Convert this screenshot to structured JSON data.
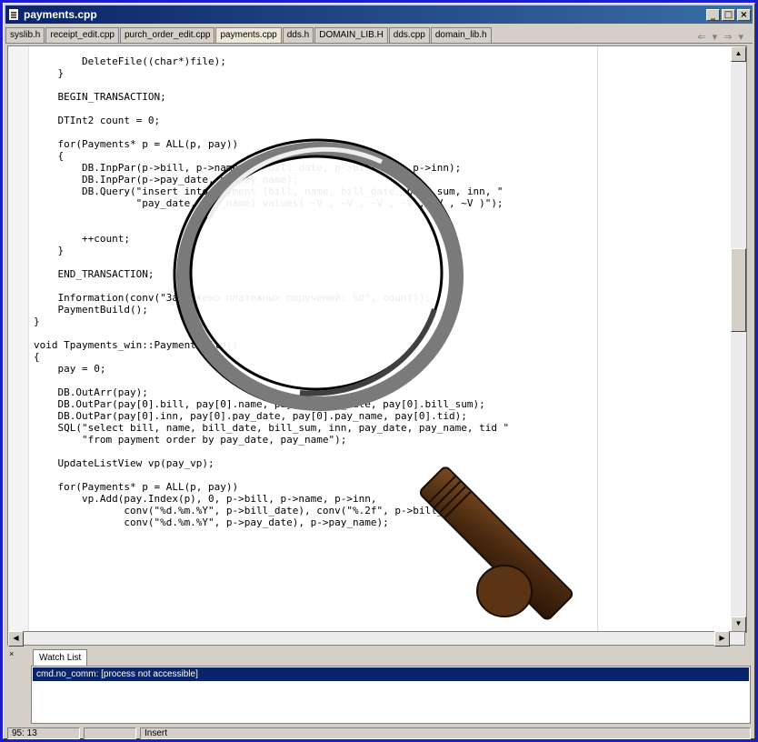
{
  "window": {
    "title": "payments.cpp",
    "btn_min": "_",
    "btn_max": "□",
    "btn_close": "×"
  },
  "tabs": [
    {
      "label": "syslib.h"
    },
    {
      "label": "receipt_edit.cpp"
    },
    {
      "label": "purch_order_edit.cpp"
    },
    {
      "label": "payments.cpp",
      "active": true
    },
    {
      "label": "dds.h"
    },
    {
      "label": "DOMAIN_LIB.H"
    },
    {
      "label": "dds.cpp"
    },
    {
      "label": "domain_lib.h"
    }
  ],
  "tab_nav": "⇐ ▾ ⇒ ▾",
  "code": {
    "lines": [
      "        DeleteFile((char*)file);",
      "    }",
      "",
      "    BEGIN_TRANSACTION;",
      "",
      "    DTInt2 count = 0;",
      "",
      "    for(Payments* p = ALL(p, pay))",
      "    {",
      "        DB.InpPar(p->bill, p->name, p->bill_date, p->bill_sum, p->inn);",
      "        DB.InpPar(p->pay_date, p->pay_name);",
      "        DB.Query(\"insert into payment (bill, name, bill_date, bill_sum, inn, \"",
      "                 \"pay_date, pay_name) values( ~V , ~V , ~V , ~V , ~V , ~V )\");",
      "",
      "",
      "        ++count;",
      "    }",
      "",
      "    END_TRANSACTION;",
      "",
      "    Information(conv(\"Загружено платежных поручений: %d\", count));",
      "    PaymentBuild();",
      "}",
      "",
      "void Tpayments_win::PaymentBuild()",
      "{",
      "    pay = 0;",
      "",
      "    DB.OutArr(pay);",
      "    DB.OutPar(pay[0].bill, pay[0].name, pay[0].bill_date, pay[0].bill_sum);",
      "    DB.OutPar(pay[0].inn, pay[0].pay_date, pay[0].pay_name, pay[0].tid);",
      "    SQL(\"select bill, name, bill_date, bill_sum, inn, pay_date, pay_name, tid \"",
      "        \"from payment order by pay_date, pay_name\");",
      "",
      "    UpdateListView vp(pay_vp);",
      "",
      "    for(Payments* p = ALL(p, pay))",
      "        vp.Add(pay.Index(p), 0, p->bill, p->name, p->inn,",
      "               conv(\"%d.%m.%Y\", p->bill_date), conv(\"%.2f\", p->bill_sum),",
      "               conv(\"%d.%m.%Y\", p->pay_date), p->pay_name);"
    ]
  },
  "watch": {
    "close": "×",
    "tab_label": "Watch List",
    "row": "cmd.no_comm: [process not accessible]"
  },
  "status": {
    "position": "95: 13",
    "mode": "Insert"
  },
  "colors": {
    "desktop": "#1d1dd0",
    "title_start": "#0a246a",
    "selection": "#0a246a"
  }
}
